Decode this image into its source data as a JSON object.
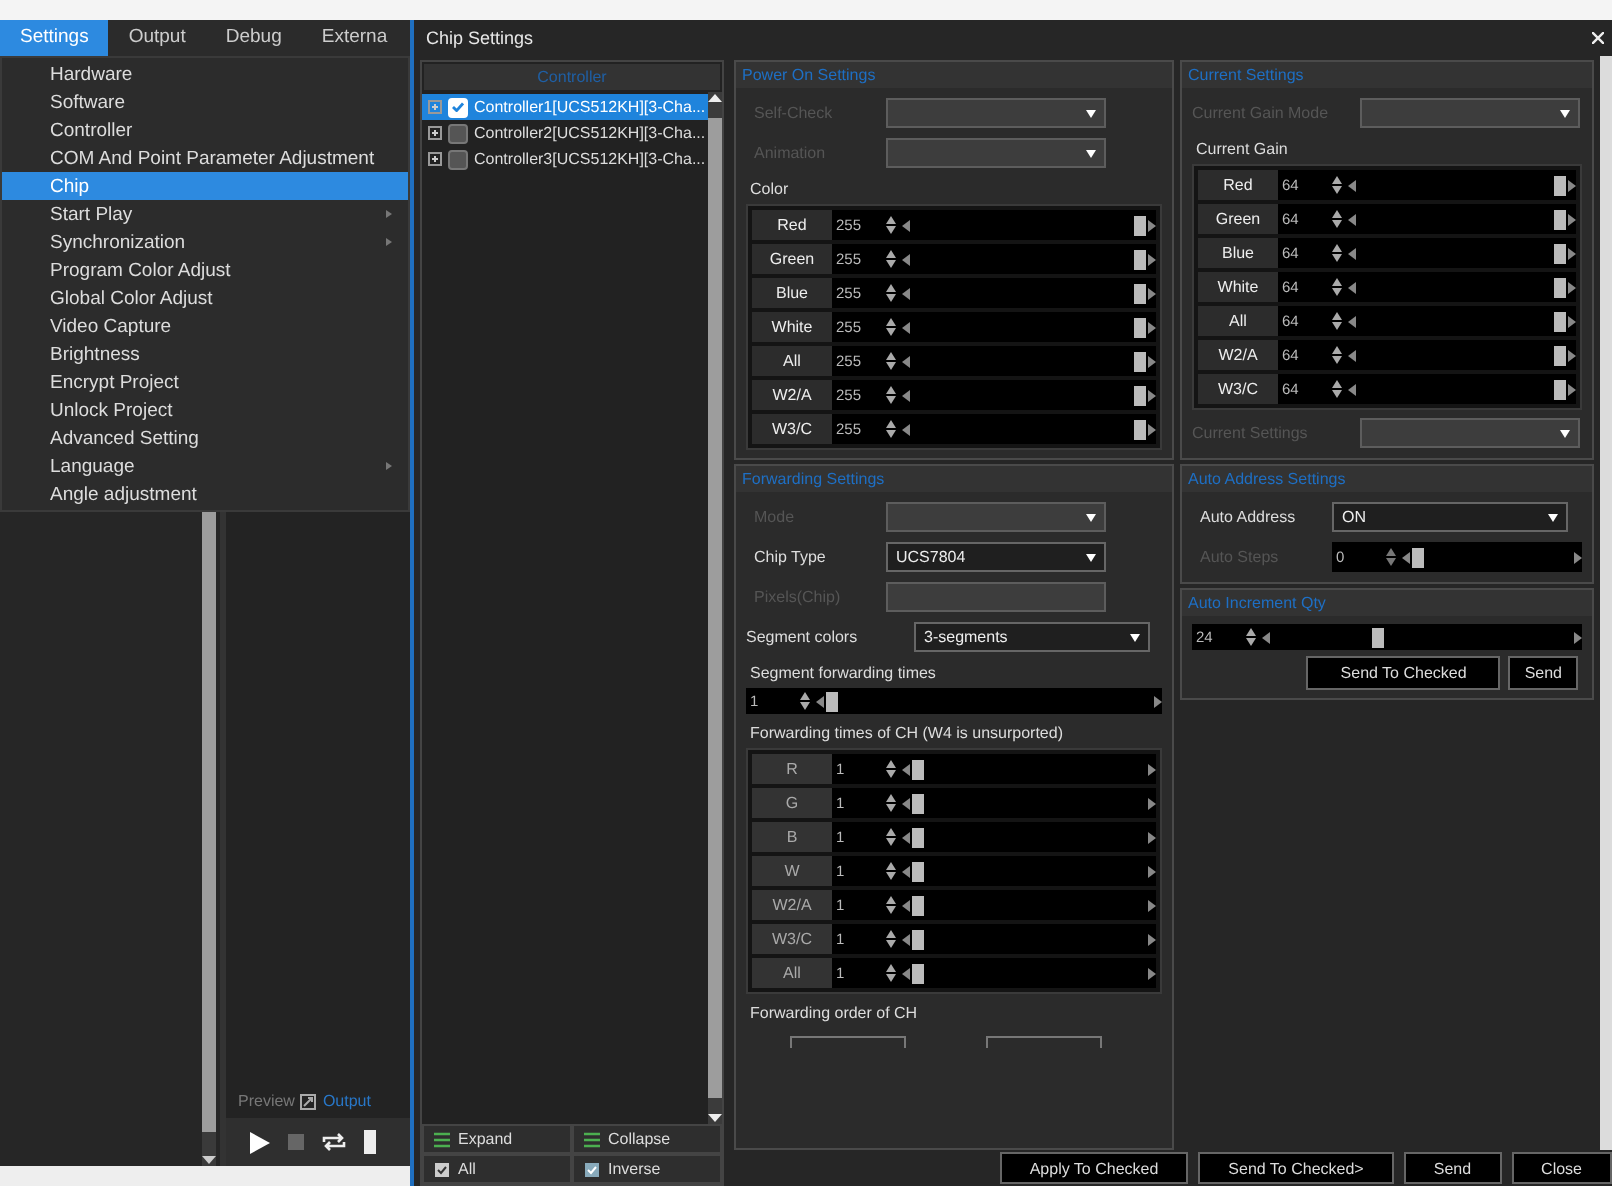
{
  "menubar": {
    "items": [
      {
        "label": "Settings",
        "selected": true
      },
      {
        "label": "Output",
        "selected": false
      },
      {
        "label": "Debug",
        "selected": false
      },
      {
        "label": "Externa",
        "selected": false
      }
    ]
  },
  "menu": {
    "items": [
      {
        "label": "Hardware",
        "selected": false,
        "submenu": false
      },
      {
        "label": "Software",
        "selected": false,
        "submenu": false
      },
      {
        "label": "Controller",
        "selected": false,
        "submenu": false
      },
      {
        "label": "COM And Point Parameter Adjustment",
        "selected": false,
        "submenu": false
      },
      {
        "label": "Chip",
        "selected": true,
        "submenu": false
      },
      {
        "label": "Start Play",
        "selected": false,
        "submenu": true
      },
      {
        "label": "Synchronization",
        "selected": false,
        "submenu": true
      },
      {
        "label": "Program Color Adjust",
        "selected": false,
        "submenu": false
      },
      {
        "label": "Global Color Adjust",
        "selected": false,
        "submenu": false
      },
      {
        "label": "Video Capture",
        "selected": false,
        "submenu": false
      },
      {
        "label": "Brightness",
        "selected": false,
        "submenu": false
      },
      {
        "label": "Encrypt Project",
        "selected": false,
        "submenu": false
      },
      {
        "label": "Unlock Project",
        "selected": false,
        "submenu": false
      },
      {
        "label": "Advanced Setting",
        "selected": false,
        "submenu": false
      },
      {
        "label": "Language",
        "selected": false,
        "submenu": true
      },
      {
        "label": "Angle adjustment",
        "selected": false,
        "submenu": false
      }
    ]
  },
  "preview_tabs": [
    {
      "label": "Preview",
      "selected": false
    },
    {
      "label": "Output",
      "selected": true
    }
  ],
  "dialog": {
    "title": "Chip Settings"
  },
  "controller_panel": {
    "header": "Controller",
    "items": [
      {
        "label": "Controller1[UCS512KH][3-Cha...",
        "checked": true,
        "selected": true
      },
      {
        "label": "Controller2[UCS512KH][3-Cha...",
        "checked": false,
        "selected": false
      },
      {
        "label": "Controller3[UCS512KH][3-Cha...",
        "checked": false,
        "selected": false
      }
    ],
    "buttons": [
      {
        "label": "Expand",
        "kind": "expand"
      },
      {
        "label": "Collapse",
        "kind": "collapse"
      },
      {
        "label": "All",
        "kind": "all"
      },
      {
        "label": "Inverse",
        "kind": "inverse"
      }
    ]
  },
  "power_on": {
    "title": "Power On Settings",
    "fields": [
      {
        "label": "Self-Check",
        "disabled": true
      },
      {
        "label": "Animation",
        "disabled": true
      }
    ],
    "color_label": "Color",
    "channels": [
      {
        "name": "Red",
        "value": "255",
        "level": 1
      },
      {
        "name": "Green",
        "value": "255",
        "level": 1
      },
      {
        "name": "Blue",
        "value": "255",
        "level": 1
      },
      {
        "name": "White",
        "value": "255",
        "level": 1
      },
      {
        "name": "All",
        "value": "255",
        "level": 1
      },
      {
        "name": "W2/A",
        "value": "255",
        "level": 1
      },
      {
        "name": "W3/C",
        "value": "255",
        "level": 1
      }
    ]
  },
  "current": {
    "title": "Current Settings",
    "mode": {
      "label": "Current Gain Mode",
      "disabled": true
    },
    "gain_label": "Current Gain",
    "channels": [
      {
        "name": "Red",
        "value": "64",
        "level": 1
      },
      {
        "name": "Green",
        "value": "64",
        "level": 1
      },
      {
        "name": "Blue",
        "value": "64",
        "level": 1
      },
      {
        "name": "White",
        "value": "64",
        "level": 1
      },
      {
        "name": "All",
        "value": "64",
        "level": 1
      },
      {
        "name": "W2/A",
        "value": "64",
        "level": 1
      },
      {
        "name": "W3/C",
        "value": "64",
        "level": 1
      }
    ],
    "settings": {
      "label": "Current Settings",
      "disabled": true
    }
  },
  "forwarding": {
    "title": "Forwarding Settings",
    "fields": [
      {
        "label": "Mode",
        "kind": "dropdown",
        "disabled": true
      },
      {
        "label": "Chip Type",
        "kind": "dropdown",
        "value": "UCS7804",
        "disabled": false
      },
      {
        "label": "Pixels(Chip)",
        "kind": "text",
        "disabled": true
      }
    ],
    "segment_colors": {
      "label": "Segment colors",
      "value": "3-segments"
    },
    "segment_times": {
      "label": "Segment forwarding times",
      "value": "1",
      "level": 0
    },
    "ch_label": "Forwarding times of CH (W4 is unsurported)",
    "channels": [
      {
        "name": "R",
        "value": "1",
        "level": 0
      },
      {
        "name": "G",
        "value": "1",
        "level": 0
      },
      {
        "name": "B",
        "value": "1",
        "level": 0
      },
      {
        "name": "W",
        "value": "1",
        "level": 0
      },
      {
        "name": "W2/A",
        "value": "1",
        "level": 0
      },
      {
        "name": "W3/C",
        "value": "1",
        "level": 0
      },
      {
        "name": "All",
        "value": "1",
        "level": 0
      }
    ],
    "order_label": "Forwarding order of CH"
  },
  "auto_address": {
    "title": "Auto Address Settings",
    "address": {
      "label": "Auto Address",
      "value": "ON"
    },
    "steps": {
      "label": "Auto Steps",
      "value": "0",
      "level": 0,
      "disabled": true
    }
  },
  "auto_increment": {
    "title": "Auto Increment Qty",
    "value": "24",
    "level": 0.35,
    "buttons": [
      "Send To Checked",
      "Send"
    ]
  },
  "buttons": [
    "Apply To Checked",
    "Send To Checked>",
    "Send",
    "Close"
  ]
}
